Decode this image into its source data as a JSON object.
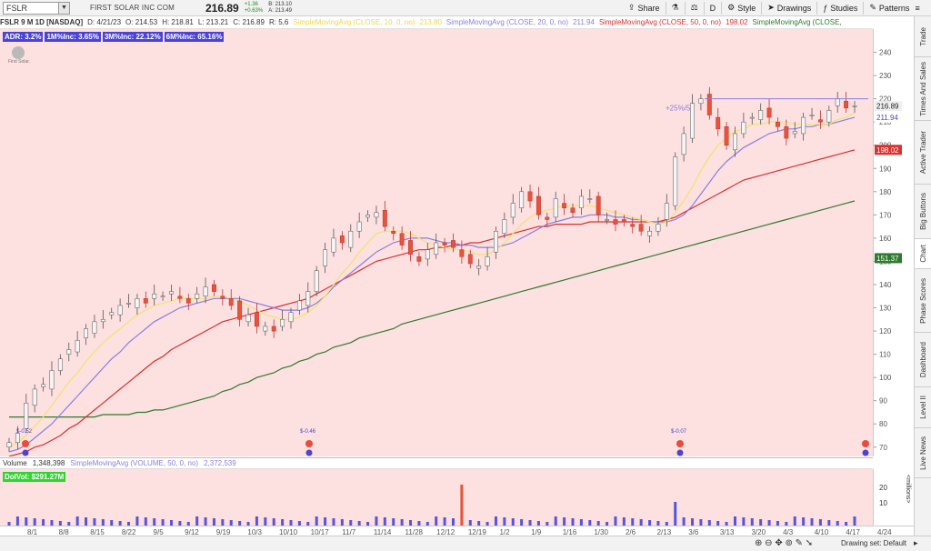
{
  "toolbar": {
    "symbol": "FSLR",
    "company": "FIRST SOLAR INC COM",
    "last_price": "216.89",
    "change_abs": "+1.36",
    "change_pct": "+0.63%",
    "bid": "B: 213.10",
    "ask": "A: 213.49",
    "share_label": "Share",
    "period_label": "D",
    "style_label": "Style",
    "drawings_label": "Drawings",
    "studies_label": "Studies",
    "patterns_label": "Patterns"
  },
  "infobar": {
    "title": "FSLR 9 M 1D [NASDAQ]",
    "date": "D: 4/21/23",
    "open": "O: 214.53",
    "high": "H: 218.81",
    "low": "L: 213.21",
    "close": "C: 216.89",
    "range": "R: 5.6",
    "ma10_label": "SimpleMovingAvg (CLOSE, 10, 0, no)",
    "ma10_value": "213.80",
    "ma20_label": "SimpleMovingAvg (CLOSE, 20, 0, no)",
    "ma20_value": "211.94",
    "ma50_label": "SimpleMovingAvg (CLOSE, 50, 0, no)",
    "ma50_value": "198.02",
    "ma200_label": "SimpleMovingAvg (CLOSE,"
  },
  "stats": {
    "adr": "ADR: 3.2%",
    "m1": "1M%Inc: 3.65%",
    "m3": "3M%Inc: 22.12%",
    "m6": "6M%Inc: 65.16%"
  },
  "logo_caption": "First Solar.",
  "annotation": "+25%/5",
  "earnings": [
    "$-0.52",
    "$-0.46",
    "$-0.07"
  ],
  "price_axis": {
    "ticks": [
      "240",
      "230",
      "220",
      "210",
      "200",
      "190",
      "180",
      "170",
      "160",
      "150",
      "140",
      "130",
      "120",
      "110",
      "100",
      "90",
      "80",
      "70"
    ],
    "labels": {
      "price": "216.89",
      "ma20": "211.94",
      "ma50": "198.02",
      "ma200": "151.37"
    }
  },
  "volume": {
    "label": "Volume",
    "value": "1,348,398",
    "ma_label": "SimpleMovingAvg (VOLUME, 50, 0, no)",
    "ma_value": "2,372,539",
    "dolvol": "DolVol: $291.27M",
    "axis_ticks": [
      "20",
      "10"
    ],
    "axis_unit": "<millions>"
  },
  "date_axis": [
    "8/1",
    "8/8",
    "8/15",
    "8/22",
    "9/5",
    "9/12",
    "9/19",
    "10/3",
    "10/10",
    "10/17",
    "11/7",
    "11/14",
    "11/28",
    "12/12",
    "12/19",
    "1/2",
    "1/9",
    "1/16",
    "1/30",
    "2/6",
    "2/13",
    "3/6",
    "3/13",
    "3/20",
    "4/3",
    "4/10",
    "4/17",
    "4/24"
  ],
  "side_tabs": [
    "Trade",
    "Times And Sales",
    "Active Trader",
    "Big Buttons",
    "Chart",
    "Phase Scores",
    "Dashboard",
    "Level II",
    "Live News"
  ],
  "status": {
    "drawing_set": "Drawing set: Default"
  },
  "colors": {
    "background": "#fde0e0",
    "up": "#f5f5f5",
    "down": "#e8533a",
    "ma10": "#f2e36a",
    "ma20": "#8a7fe0",
    "ma50": "#d93030",
    "ma200": "#2e7a2e",
    "volume": "#5555dd"
  },
  "chart_data": {
    "type": "candlestick",
    "y_axis_range": [
      66,
      250
    ],
    "price_series_close": [
      72,
      76,
      89,
      95,
      97,
      103,
      108,
      112,
      116,
      121,
      124,
      125,
      128,
      131,
      132,
      134,
      132,
      136,
      135,
      137,
      134,
      132,
      136,
      139,
      137,
      134,
      131,
      125,
      127,
      122,
      122,
      120,
      125,
      128,
      133,
      137,
      146,
      155,
      160,
      158,
      163,
      167,
      170,
      171,
      165,
      162,
      157,
      153,
      150,
      155,
      158,
      157,
      156,
      152,
      149,
      148,
      152,
      163,
      168,
      175,
      180,
      176,
      170,
      168,
      177,
      173,
      171,
      178,
      177,
      170,
      168,
      166,
      167,
      165,
      163,
      163,
      166,
      175,
      195,
      205,
      218,
      220,
      213,
      207,
      200,
      205,
      210,
      212,
      215,
      212,
      208,
      203,
      206,
      212,
      213,
      210,
      215,
      220,
      216,
      217
    ],
    "ma10": [
      70,
      72,
      75,
      79,
      83,
      88,
      93,
      98,
      102,
      107,
      111,
      115,
      118,
      121,
      124,
      127,
      129,
      131,
      132,
      133,
      134,
      134,
      134,
      134,
      135,
      135,
      134,
      133,
      131,
      129,
      127,
      126,
      125,
      125,
      126,
      128,
      131,
      135,
      140,
      145,
      149,
      154,
      158,
      162,
      163,
      163,
      163,
      162,
      160,
      158,
      157,
      156,
      155,
      155,
      154,
      153,
      153,
      155,
      158,
      162,
      166,
      169,
      171,
      172,
      173,
      174,
      174,
      174,
      174,
      173,
      172,
      171,
      170,
      169,
      168,
      167,
      166,
      167,
      171,
      176,
      182,
      189,
      195,
      200,
      203,
      206,
      207,
      209,
      209,
      210,
      210,
      210,
      209,
      209,
      209,
      209,
      209,
      211,
      212,
      214
    ],
    "ma20": [
      68,
      69,
      71,
      74,
      77,
      80,
      84,
      88,
      92,
      96,
      100,
      104,
      108,
      111,
      115,
      118,
      121,
      124,
      126,
      128,
      130,
      131,
      132,
      133,
      134,
      134,
      134,
      134,
      133,
      132,
      131,
      130,
      129,
      129,
      129,
      130,
      132,
      135,
      139,
      142,
      145,
      148,
      151,
      154,
      156,
      158,
      159,
      160,
      160,
      160,
      159,
      158,
      158,
      157,
      157,
      156,
      156,
      156,
      157,
      158,
      160,
      162,
      164,
      166,
      167,
      168,
      169,
      169,
      170,
      170,
      170,
      169,
      169,
      168,
      168,
      167,
      167,
      167,
      168,
      170,
      174,
      179,
      184,
      189,
      193,
      196,
      199,
      201,
      203,
      205,
      206,
      207,
      207,
      208,
      208,
      209,
      209,
      210,
      211,
      212
    ],
    "ma50": [
      66,
      67,
      68,
      70,
      71,
      73,
      75,
      78,
      80,
      83,
      86,
      89,
      92,
      95,
      98,
      101,
      104,
      107,
      109,
      112,
      114,
      116,
      118,
      120,
      122,
      124,
      125,
      126,
      127,
      128,
      129,
      130,
      131,
      132,
      133,
      134,
      136,
      138,
      140,
      142,
      144,
      146,
      148,
      150,
      151,
      152,
      153,
      154,
      155,
      155,
      156,
      156,
      157,
      157,
      158,
      158,
      159,
      160,
      161,
      162,
      163,
      164,
      165,
      165,
      166,
      166,
      166,
      166,
      167,
      167,
      167,
      167,
      167,
      167,
      167,
      167,
      167,
      168,
      169,
      171,
      173,
      175,
      177,
      179,
      181,
      183,
      185,
      186,
      187,
      188,
      189,
      190,
      191,
      192,
      193,
      194,
      195,
      196,
      197,
      198
    ],
    "ma200": [
      83,
      83,
      83,
      83,
      83,
      83,
      83,
      83,
      83,
      83,
      83,
      84,
      84,
      84,
      84,
      85,
      85,
      86,
      86,
      87,
      88,
      89,
      90,
      91,
      92,
      94,
      95,
      97,
      98,
      100,
      101,
      102,
      104,
      105,
      107,
      108,
      110,
      111,
      113,
      114,
      115,
      117,
      118,
      119,
      120,
      121,
      123,
      124,
      125,
      126,
      127,
      128,
      129,
      130,
      131,
      132,
      133,
      134,
      135,
      136,
      137,
      138,
      139,
      140,
      141,
      142,
      143,
      144,
      145,
      146,
      147,
      148,
      149,
      150,
      151,
      152,
      153,
      154,
      155,
      156,
      157,
      158,
      159,
      160,
      161,
      162,
      163,
      164,
      165,
      166,
      167,
      168,
      169,
      170,
      171,
      172,
      173,
      174,
      175,
      176
    ]
  }
}
